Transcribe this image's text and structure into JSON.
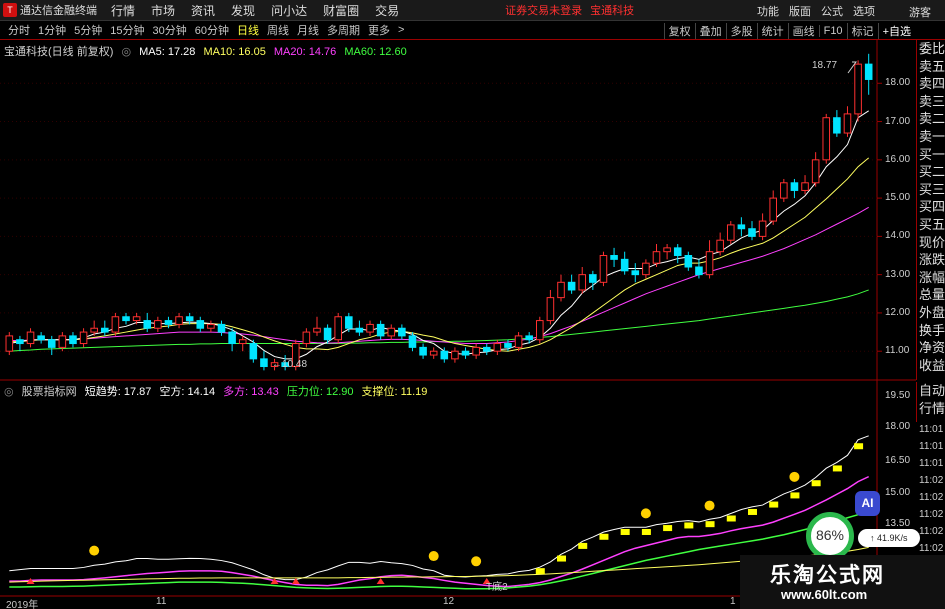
{
  "app": {
    "title": "通达信金融终端",
    "menu": [
      "行情",
      "市场",
      "资讯",
      "发现",
      "问小达",
      "财富圈",
      "交易"
    ],
    "login_warning": "证券交易未登录",
    "stock_name": "宝通科技",
    "right_menu": [
      "功能",
      "版面",
      "公式",
      "选项"
    ],
    "guest": "游客"
  },
  "toolbar": {
    "periods": [
      "分时",
      "1分钟",
      "5分钟",
      "15分钟",
      "30分钟",
      "60分钟",
      "日线",
      "周线",
      "月线",
      "多周期",
      "更多"
    ],
    "active_period": "日线",
    "tools": [
      "复权",
      "叠加",
      "多股",
      "统计",
      "画线",
      "F10",
      "标记",
      "+自选"
    ]
  },
  "main_legend": {
    "title": "宝通科技(日线 前复权)",
    "ma5": "MA5: 17.28",
    "ma10": "MA10: 16.05",
    "ma20": "MA20: 14.76",
    "ma60": "MA60: 12.60"
  },
  "indicator_legend": {
    "name": "股票指标网",
    "trend": "短趋势: 17.87",
    "bear": "空方: 14.14",
    "bull": "多方: 13.43",
    "pressure": "压力位: 12.90",
    "support": "支撑位: 11.19"
  },
  "order_book": [
    "委比",
    "卖五",
    "卖四",
    "卖三",
    "卖二",
    "卖一",
    "买一",
    "买二",
    "买三",
    "买四",
    "买五",
    "现价",
    "涨跌",
    "涨幅",
    "总量",
    "外盘",
    "换手",
    "净资",
    "收益"
  ],
  "order_book_2": [
    "自动",
    "行情"
  ],
  "price_axis": [
    "18.00",
    "17.00",
    "16.00",
    "15.00",
    "14.00",
    "13.00",
    "12.00",
    "11.00"
  ],
  "indicator_axis": [
    "19.50",
    "18.00",
    "16.50",
    "15.00",
    "13.50"
  ],
  "time_axis": [
    "2019年",
    "11",
    "12",
    "1"
  ],
  "time_readouts": [
    "11:01",
    "11:01",
    "11:01",
    "11:02",
    "11:02",
    "11:02",
    "11:02",
    "11:02"
  ],
  "annotations": {
    "high": "18.77",
    "low": "10.48",
    "bottom_signal": "T底2"
  },
  "overlay": {
    "ai": "AI",
    "speed": "86%",
    "net": "41.9K/s"
  },
  "watermark": {
    "title": "乐淘公式网",
    "url": "www.60lt.com"
  },
  "colors": {
    "up": "#ff3030",
    "down": "#00e5ff",
    "ma5": "#ffffff",
    "ma10": "#ffff60",
    "ma20": "#ff40ff",
    "ma60": "#40ff40"
  },
  "chart_data": {
    "type": "candlestick",
    "ylim": [
      10.3,
      19.0
    ],
    "candles": [
      [
        11.0,
        11.4,
        11.5,
        10.9
      ],
      [
        11.3,
        11.2,
        11.4,
        11.0
      ],
      [
        11.2,
        11.5,
        11.6,
        11.1
      ],
      [
        11.4,
        11.3,
        11.5,
        11.2
      ],
      [
        11.3,
        11.1,
        11.4,
        10.9
      ],
      [
        11.1,
        11.4,
        11.5,
        11.0
      ],
      [
        11.4,
        11.2,
        11.5,
        11.1
      ],
      [
        11.2,
        11.5,
        11.6,
        11.1
      ],
      [
        11.5,
        11.6,
        11.8,
        11.4
      ],
      [
        11.6,
        11.5,
        11.8,
        11.4
      ],
      [
        11.5,
        11.9,
        12.0,
        11.4
      ],
      [
        11.9,
        11.8,
        12.0,
        11.7
      ],
      [
        11.8,
        11.9,
        12.0,
        11.7
      ],
      [
        11.8,
        11.6,
        12.0,
        11.5
      ],
      [
        11.6,
        11.8,
        11.9,
        11.5
      ],
      [
        11.8,
        11.7,
        11.9,
        11.6
      ],
      [
        11.7,
        11.9,
        12.0,
        11.6
      ],
      [
        11.9,
        11.8,
        12.0,
        11.7
      ],
      [
        11.8,
        11.6,
        11.9,
        11.5
      ],
      [
        11.6,
        11.7,
        11.8,
        11.5
      ],
      [
        11.7,
        11.5,
        11.8,
        11.4
      ],
      [
        11.5,
        11.2,
        11.6,
        11.0
      ],
      [
        11.2,
        11.3,
        11.4,
        11.0
      ],
      [
        11.2,
        10.8,
        11.3,
        10.7
      ],
      [
        10.8,
        10.6,
        11.0,
        10.5
      ],
      [
        10.6,
        10.7,
        10.8,
        10.5
      ],
      [
        10.7,
        10.6,
        10.9,
        10.5
      ],
      [
        10.6,
        11.2,
        11.3,
        10.5
      ],
      [
        11.2,
        11.5,
        11.6,
        11.1
      ],
      [
        11.5,
        11.6,
        11.9,
        11.4
      ],
      [
        11.6,
        11.3,
        11.7,
        11.2
      ],
      [
        11.3,
        11.9,
        12.0,
        11.2
      ],
      [
        11.9,
        11.6,
        12.0,
        11.5
      ],
      [
        11.6,
        11.5,
        11.8,
        11.4
      ],
      [
        11.5,
        11.7,
        11.8,
        11.4
      ],
      [
        11.7,
        11.4,
        11.8,
        11.3
      ],
      [
        11.4,
        11.6,
        11.7,
        11.3
      ],
      [
        11.6,
        11.4,
        11.7,
        11.3
      ],
      [
        11.4,
        11.1,
        11.5,
        11.0
      ],
      [
        11.1,
        10.9,
        11.2,
        10.8
      ],
      [
        10.9,
        11.0,
        11.1,
        10.8
      ],
      [
        11.0,
        10.8,
        11.1,
        10.7
      ],
      [
        10.8,
        11.0,
        11.1,
        10.7
      ],
      [
        11.0,
        10.9,
        11.1,
        10.8
      ],
      [
        10.9,
        11.1,
        11.2,
        10.8
      ],
      [
        11.1,
        11.0,
        11.2,
        10.9
      ],
      [
        11.0,
        11.2,
        11.3,
        10.9
      ],
      [
        11.2,
        11.1,
        11.3,
        11.0
      ],
      [
        11.1,
        11.4,
        11.5,
        11.0
      ],
      [
        11.4,
        11.3,
        11.5,
        11.2
      ],
      [
        11.3,
        11.8,
        11.9,
        11.2
      ],
      [
        11.8,
        12.4,
        12.6,
        11.7
      ],
      [
        12.4,
        12.8,
        13.0,
        12.3
      ],
      [
        12.8,
        12.6,
        13.0,
        12.5
      ],
      [
        12.6,
        13.0,
        13.2,
        12.5
      ],
      [
        13.0,
        12.8,
        13.1,
        12.6
      ],
      [
        12.8,
        13.5,
        13.6,
        12.7
      ],
      [
        13.5,
        13.4,
        13.7,
        13.2
      ],
      [
        13.4,
        13.1,
        13.6,
        13.0
      ],
      [
        13.1,
        13.0,
        13.3,
        12.8
      ],
      [
        13.0,
        13.3,
        13.4,
        12.9
      ],
      [
        13.3,
        13.6,
        13.8,
        13.2
      ],
      [
        13.6,
        13.7,
        13.8,
        13.4
      ],
      [
        13.7,
        13.5,
        13.8,
        13.3
      ],
      [
        13.5,
        13.2,
        13.6,
        13.1
      ],
      [
        13.2,
        13.0,
        13.4,
        12.9
      ],
      [
        13.0,
        13.6,
        13.9,
        12.9
      ],
      [
        13.6,
        13.9,
        14.1,
        13.5
      ],
      [
        13.9,
        14.3,
        14.4,
        13.8
      ],
      [
        14.3,
        14.2,
        14.5,
        14.0
      ],
      [
        14.2,
        14.0,
        14.4,
        13.9
      ],
      [
        14.0,
        14.4,
        14.6,
        13.9
      ],
      [
        14.4,
        15.0,
        15.2,
        14.3
      ],
      [
        15.0,
        15.4,
        15.5,
        14.9
      ],
      [
        15.4,
        15.2,
        15.5,
        15.0
      ],
      [
        15.2,
        15.4,
        15.6,
        15.1
      ],
      [
        15.4,
        16.0,
        16.2,
        15.3
      ],
      [
        16.0,
        17.1,
        17.2,
        15.9
      ],
      [
        17.1,
        16.7,
        17.3,
        16.6
      ],
      [
        16.7,
        17.2,
        17.4,
        16.6
      ],
      [
        17.2,
        18.5,
        18.6,
        17.0
      ],
      [
        18.5,
        18.1,
        18.77,
        17.7
      ]
    ],
    "ma5": [
      11.2,
      11.25,
      11.3,
      11.3,
      11.3,
      11.3,
      11.3,
      11.35,
      11.45,
      11.5,
      11.6,
      11.65,
      11.75,
      11.75,
      11.72,
      11.72,
      11.74,
      11.76,
      11.75,
      11.72,
      11.66,
      11.56,
      11.4,
      11.24,
      11.02,
      10.86,
      10.8,
      10.8,
      10.92,
      11.12,
      11.24,
      11.42,
      11.58,
      11.58,
      11.54,
      11.62,
      11.56,
      11.52,
      11.44,
      11.28,
      11.2,
      11.0,
      10.94,
      10.92,
      10.96,
      10.98,
      11.04,
      11.06,
      11.16,
      11.22,
      11.36,
      11.6,
      11.94,
      12.18,
      12.52,
      12.72,
      12.94,
      13.06,
      13.16,
      13.16,
      13.16,
      13.28,
      13.34,
      13.42,
      13.46,
      13.4,
      13.52,
      13.6,
      13.78,
      13.96,
      14.08,
      14.16,
      14.42,
      14.66,
      14.84,
      15.06,
      15.4,
      15.82,
      16.08,
      16.4,
      17.1,
      17.28
    ],
    "ma10": [
      11.25,
      11.25,
      11.28,
      11.3,
      11.3,
      11.3,
      11.3,
      11.32,
      11.36,
      11.4,
      11.45,
      11.5,
      11.55,
      11.6,
      11.63,
      11.66,
      11.7,
      11.72,
      11.72,
      11.72,
      11.7,
      11.64,
      11.56,
      11.48,
      11.37,
      11.27,
      11.18,
      11.1,
      11.06,
      11.06,
      11.04,
      11.1,
      11.2,
      11.3,
      11.36,
      11.45,
      11.5,
      11.52,
      11.48,
      11.42,
      11.37,
      11.28,
      11.2,
      11.15,
      11.1,
      11.05,
      11.02,
      11.0,
      11.05,
      11.1,
      11.18,
      11.3,
      11.46,
      11.62,
      11.8,
      12.0,
      12.2,
      12.4,
      12.6,
      12.76,
      12.88,
      13.0,
      13.12,
      13.24,
      13.3,
      13.3,
      13.36,
      13.44,
      13.56,
      13.66,
      13.74,
      13.82,
      13.96,
      14.14,
      14.32,
      14.5,
      14.74,
      14.98,
      15.24,
      15.5,
      15.82,
      16.05
    ],
    "ma20": [
      11.28,
      11.28,
      11.29,
      11.3,
      11.3,
      11.3,
      11.31,
      11.32,
      11.34,
      11.36,
      11.38,
      11.4,
      11.42,
      11.44,
      11.46,
      11.48,
      11.5,
      11.5,
      11.5,
      11.5,
      11.49,
      11.47,
      11.45,
      11.42,
      11.38,
      11.34,
      11.3,
      11.26,
      11.24,
      11.22,
      11.21,
      11.22,
      11.24,
      11.26,
      11.28,
      11.3,
      11.31,
      11.31,
      11.3,
      11.28,
      11.26,
      11.24,
      11.22,
      11.2,
      11.2,
      11.2,
      11.22,
      11.24,
      11.28,
      11.32,
      11.38,
      11.46,
      11.56,
      11.66,
      11.78,
      11.9,
      12.02,
      12.14,
      12.26,
      12.38,
      12.5,
      12.6,
      12.7,
      12.8,
      12.9,
      13.0,
      13.08,
      13.16,
      13.24,
      13.32,
      13.4,
      13.48,
      13.58,
      13.68,
      13.8,
      13.92,
      14.04,
      14.18,
      14.32,
      14.46,
      14.6,
      14.76
    ],
    "ma60": [
      11.0,
      11.02,
      11.03,
      11.05,
      11.06,
      11.07,
      11.08,
      11.09,
      11.1,
      11.11,
      11.12,
      11.13,
      11.14,
      11.15,
      11.16,
      11.17,
      11.18,
      11.18,
      11.19,
      11.19,
      11.2,
      11.2,
      11.2,
      11.2,
      11.2,
      11.2,
      11.2,
      11.2,
      11.2,
      11.2,
      11.2,
      11.2,
      11.21,
      11.21,
      11.22,
      11.22,
      11.23,
      11.23,
      11.24,
      11.24,
      11.25,
      11.25,
      11.26,
      11.26,
      11.27,
      11.28,
      11.29,
      11.3,
      11.32,
      11.34,
      11.36,
      11.38,
      11.41,
      11.44,
      11.47,
      11.5,
      11.53,
      11.56,
      11.59,
      11.62,
      11.65,
      11.68,
      11.71,
      11.74,
      11.77,
      11.8,
      11.84,
      11.88,
      11.92,
      11.96,
      12.0,
      12.04,
      12.08,
      12.12,
      12.16,
      12.2,
      12.25,
      12.3,
      12.36,
      12.42,
      12.5,
      12.6
    ]
  }
}
